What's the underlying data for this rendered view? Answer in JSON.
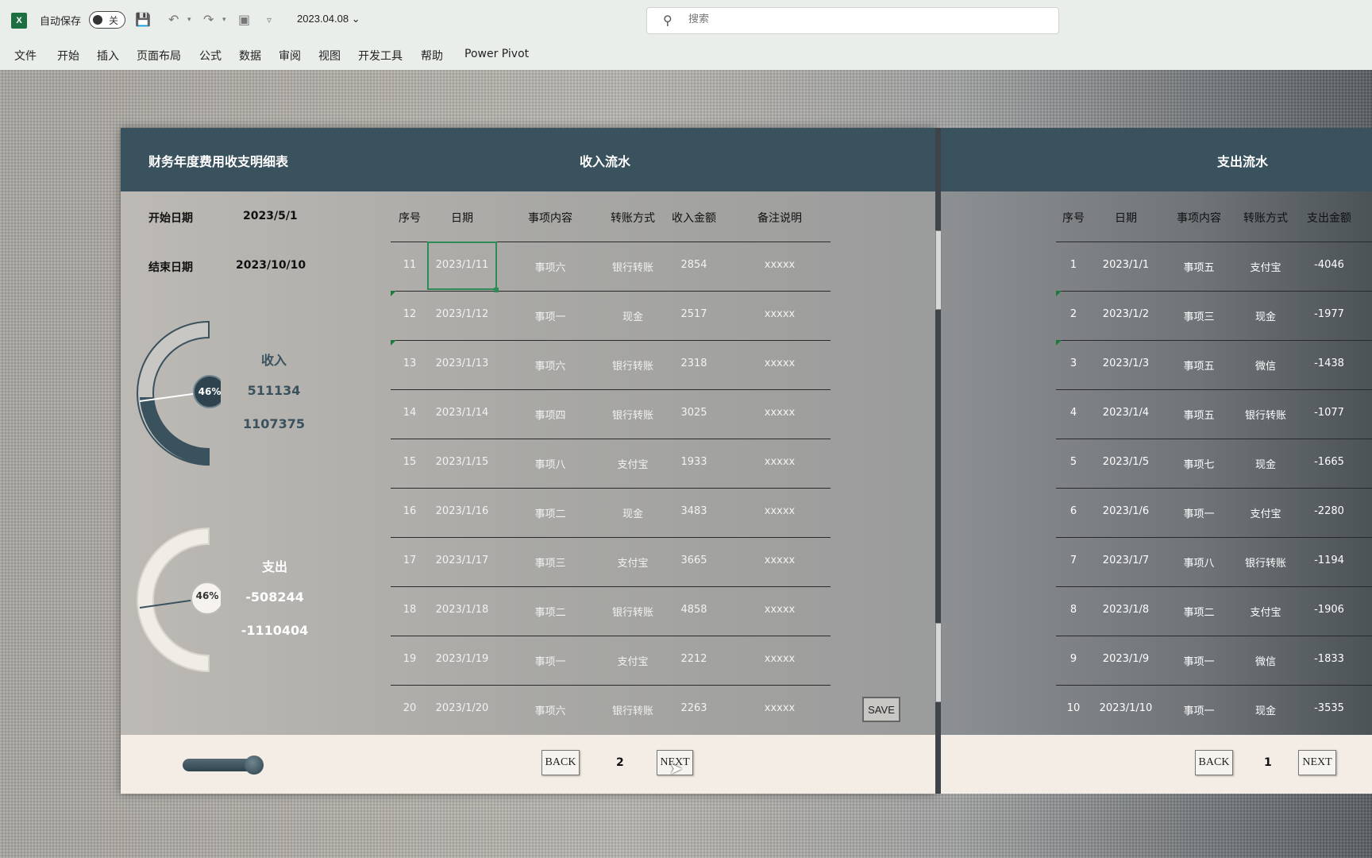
{
  "titlebar": {
    "logo": "X",
    "autosave_label": "自动保存",
    "toggle_state": "关",
    "filename": "2023.04.08",
    "search_placeholder": "搜索"
  },
  "ribbon": {
    "tabs": [
      "文件",
      "开始",
      "插入",
      "页面布局",
      "公式",
      "数据",
      "审阅",
      "视图",
      "开发工具",
      "帮助",
      "Power Pivot"
    ]
  },
  "dashboard": {
    "title": "财务年度费用收支明细表",
    "income_title": "收入流水",
    "expense_title": "支出流水",
    "start_label": "开始日期",
    "start_value": "2023/5/1",
    "end_label": "结束日期",
    "end_value": "2023/10/10",
    "income_gauge": {
      "label": "收入",
      "value": "511134",
      "total": "1107375",
      "percent": "46%"
    },
    "expense_gauge": {
      "label": "支出",
      "value": "-508244",
      "total": "-1110404",
      "percent": "46%"
    },
    "save_label": "SAVE",
    "income_pager": {
      "back": "BACK",
      "page": "2",
      "next": "NEXT"
    },
    "expense_pager": {
      "back": "BACK",
      "page": "1",
      "next": "NEXT"
    }
  },
  "income_table": {
    "headers": [
      "序号",
      "日期",
      "事项内容",
      "转账方式",
      "收入金额",
      "备注说明"
    ],
    "rows": [
      [
        "11",
        "2023/1/11",
        "事项六",
        "银行转账",
        "2854",
        "xxxxx"
      ],
      [
        "12",
        "2023/1/12",
        "事项一",
        "现金",
        "2517",
        "xxxxx"
      ],
      [
        "13",
        "2023/1/13",
        "事项六",
        "银行转账",
        "2318",
        "xxxxx"
      ],
      [
        "14",
        "2023/1/14",
        "事项四",
        "银行转账",
        "3025",
        "xxxxx"
      ],
      [
        "15",
        "2023/1/15",
        "事项八",
        "支付宝",
        "1933",
        "xxxxx"
      ],
      [
        "16",
        "2023/1/16",
        "事项二",
        "现金",
        "3483",
        "xxxxx"
      ],
      [
        "17",
        "2023/1/17",
        "事项三",
        "支付宝",
        "3665",
        "xxxxx"
      ],
      [
        "18",
        "2023/1/18",
        "事项二",
        "银行转账",
        "4858",
        "xxxxx"
      ],
      [
        "19",
        "2023/1/19",
        "事项一",
        "支付宝",
        "2212",
        "xxxxx"
      ],
      [
        "20",
        "2023/1/20",
        "事项六",
        "银行转账",
        "2263",
        "xxxxx"
      ]
    ]
  },
  "expense_table": {
    "headers": [
      "序号",
      "日期",
      "事项内容",
      "转账方式",
      "支出金额"
    ],
    "rows": [
      [
        "1",
        "2023/1/1",
        "事项五",
        "支付宝",
        "-4046"
      ],
      [
        "2",
        "2023/1/2",
        "事项三",
        "现金",
        "-1977"
      ],
      [
        "3",
        "2023/1/3",
        "事项五",
        "微信",
        "-1438"
      ],
      [
        "4",
        "2023/1/4",
        "事项五",
        "银行转账",
        "-1077"
      ],
      [
        "5",
        "2023/1/5",
        "事项七",
        "现金",
        "-1665"
      ],
      [
        "6",
        "2023/1/6",
        "事项一",
        "支付宝",
        "-2280"
      ],
      [
        "7",
        "2023/1/7",
        "事项八",
        "银行转账",
        "-1194"
      ],
      [
        "8",
        "2023/1/8",
        "事项二",
        "支付宝",
        "-1906"
      ],
      [
        "9",
        "2023/1/9",
        "事项一",
        "微信",
        "-1833"
      ],
      [
        "10",
        "2023/1/10",
        "事项一",
        "现金",
        "-3535"
      ]
    ]
  }
}
